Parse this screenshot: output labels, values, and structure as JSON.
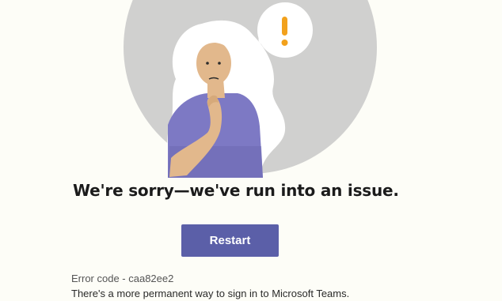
{
  "error_screen": {
    "headline": "We're sorry—we've run into an issue.",
    "restart_label": "Restart",
    "error_code": "Error code - caa82ee2",
    "signin_message": "There's a more permanent way to sign in to Microsoft Teams."
  },
  "illustration": {
    "description_icon": "confused-woman-illustration",
    "thought_bubble_symbol": "!",
    "colors": {
      "background_circle": "#d0d0cf",
      "shirt": "#7d79c4",
      "shirt_shadow": "#6d69b3",
      "skin": "#e2b88c",
      "hair": "#ffffff",
      "exclamation": "#f2a11c"
    }
  },
  "theme": {
    "page_background": "#fdfdf7",
    "button_background": "#5b5fa8",
    "button_text": "#ffffff"
  }
}
